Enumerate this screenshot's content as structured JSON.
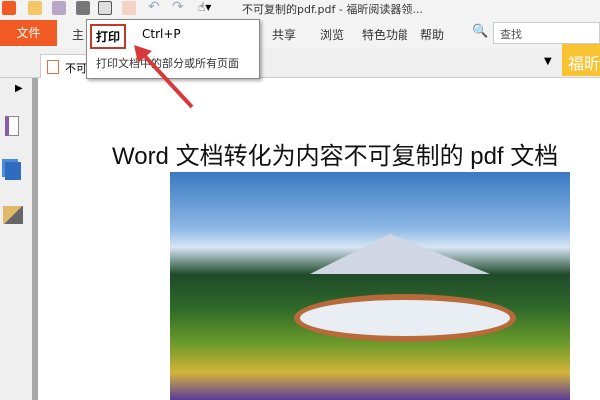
{
  "window": {
    "title": "不可复制的pdf.pdf - 福昕阅读器领..."
  },
  "ribbon": {
    "file": "文件",
    "menus": [
      "主",
      "共享",
      "浏览",
      "特色功能",
      "帮助"
    ],
    "search_placeholder": "查找"
  },
  "tab": {
    "label": "不可"
  },
  "brand": "福昕",
  "tooltip": {
    "title": "打印",
    "shortcut": "Ctrl+P",
    "description": "打印文档中的部分或所有页面"
  },
  "document": {
    "heading": "Word 文档转化为内容不可复制的 pdf 文档"
  },
  "colors": {
    "accent": "#f15a22",
    "highlight": "#c0392b",
    "brand": "#f7c332"
  }
}
